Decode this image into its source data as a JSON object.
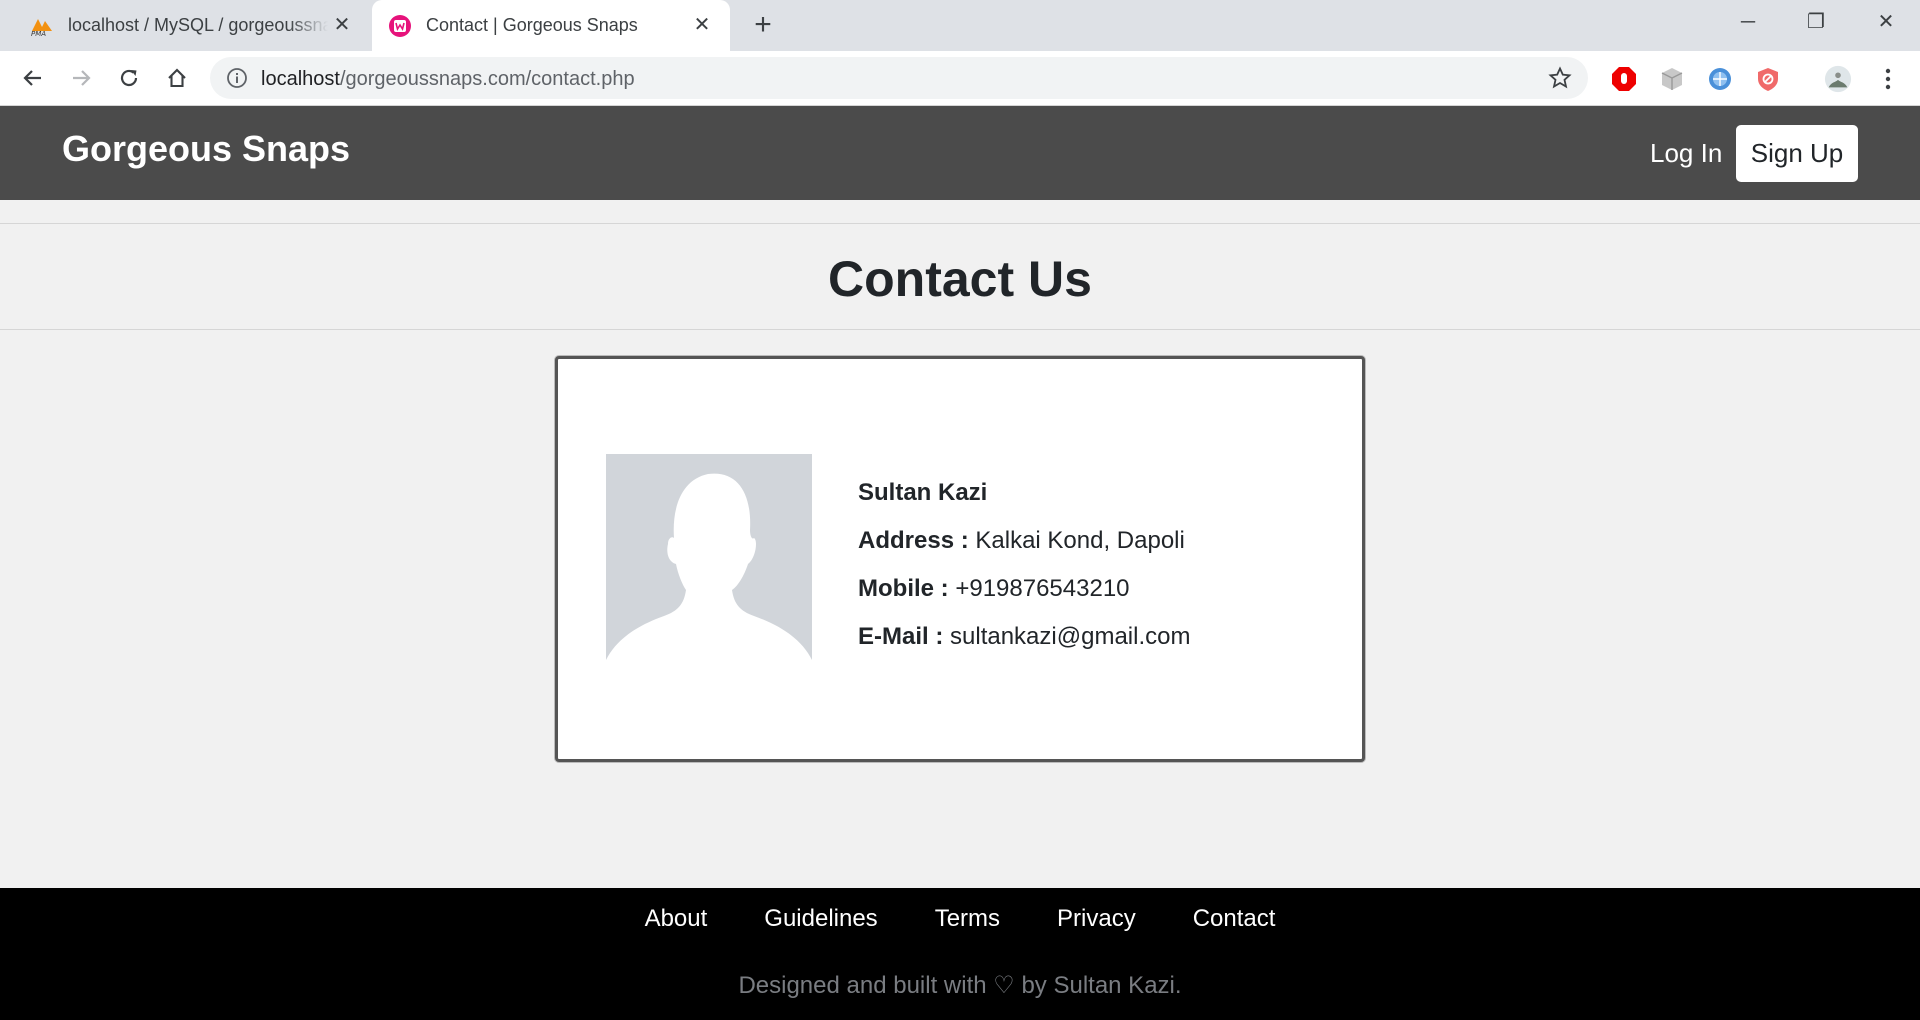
{
  "browser": {
    "tabs": [
      {
        "title": "localhost / MySQL / gorgeoussnaps",
        "icon": "phpmyadmin-icon",
        "active": false
      },
      {
        "title": "Contact | Gorgeous Snaps",
        "icon": "wamp-icon",
        "active": true
      }
    ],
    "new_tab": "+",
    "url_host": "localhost",
    "url_path": "/gorgeoussnaps.com/contact.php",
    "window_controls": {
      "minimize": "─",
      "restore": "❐",
      "close": "✕"
    }
  },
  "nav": {
    "brand": "Gorgeous Snaps",
    "login": "Log In",
    "signup": "Sign Up"
  },
  "page": {
    "title": "Contact Us"
  },
  "contact": {
    "name": "Sultan Kazi",
    "address_label": "Address :",
    "address": "Kalkai Kond, Dapoli",
    "mobile_label": "Mobile :",
    "mobile": "+919876543210",
    "email_label": "E-Mail :",
    "email": "sultankazi@gmail.com"
  },
  "footer": {
    "links": [
      "About",
      "Guidelines",
      "Terms",
      "Privacy",
      "Contact"
    ],
    "credit": "Designed and built with ♡ by Sultan Kazi."
  },
  "colors": {
    "navbar": "#4b4b4b",
    "footer": "#000000",
    "page_bg": "#f1f1f1",
    "avatar_bg": "#d1d5da"
  }
}
